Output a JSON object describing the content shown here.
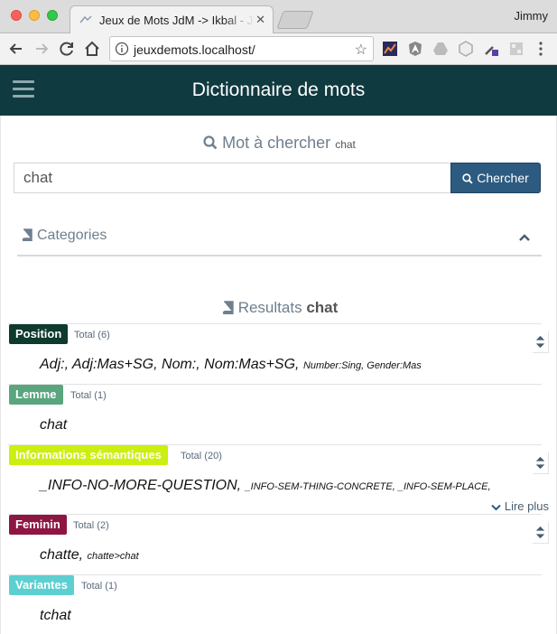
{
  "browser": {
    "tab_title": "Jeux de Mots JdM -> Ikbal - Ji",
    "url": "jeuxdemots.localhost/",
    "profile_name": "Jimmy"
  },
  "app": {
    "title": "Dictionnaire de mots"
  },
  "search": {
    "heading": "Mot à chercher",
    "heading_word": "chat",
    "input_value": "chat",
    "button_label": "Chercher"
  },
  "categories": {
    "title": "Categories"
  },
  "results": {
    "heading": "Resultats",
    "word": "chat",
    "relations": [
      {
        "name": "Position",
        "total": "Total (6)",
        "color": "#0f3a2e",
        "values_main": "Adj:, Adj:Mas+SG, Nom:, Nom:Mas+SG,",
        "values_small": "Number:Sing, Gender:Mas",
        "has_sort": true,
        "read_more": ""
      },
      {
        "name": "Lemme",
        "total": "Total (1)",
        "color": "#5aa57e",
        "values_main": "chat",
        "values_small": "",
        "has_sort": false,
        "read_more": ""
      },
      {
        "name": "Informations sémantiques",
        "total": "Total (20)",
        "color": "#ccee11",
        "values_main": "_INFO-NO-MORE-QUESTION,",
        "values_small": "_INFO-SEM-THING-CONCRETE, _INFO-SEM-PLACE,",
        "has_sort": true,
        "read_more": "Lire plus"
      },
      {
        "name": "Feminin",
        "total": "Total (2)",
        "color": "#8e1642",
        "values_main": "chatte,",
        "values_small": "chatte>chat",
        "has_sort": true,
        "read_more": ""
      },
      {
        "name": "Variantes",
        "total": "Total (1)",
        "color": "#5ecfd1",
        "values_main": "tchat",
        "values_small": "",
        "has_sort": false,
        "read_more": ""
      }
    ]
  }
}
